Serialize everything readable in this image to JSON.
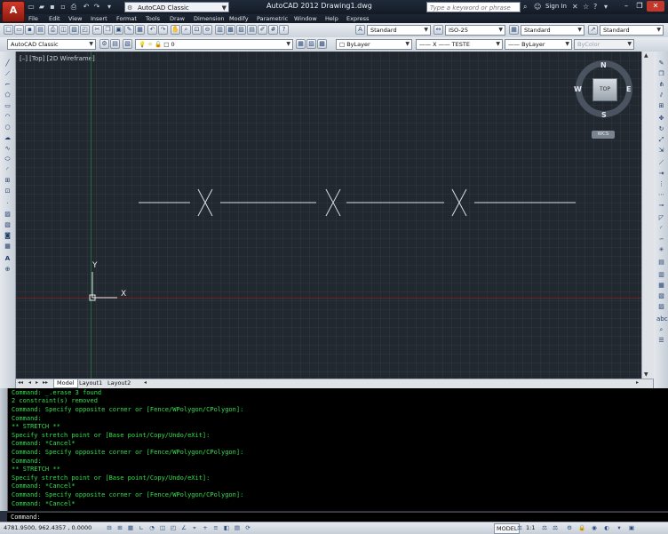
{
  "titlebar": {
    "app_button_label": "A",
    "workspace": "AutoCAD Classic",
    "title": "AutoCAD 2012    Drawing1.dwg",
    "search_placeholder": "Type a keyword or phrase",
    "sign_in": "Sign In"
  },
  "menus": [
    "File",
    "Edit",
    "View",
    "Insert",
    "Format",
    "Tools",
    "Draw",
    "Dimension",
    "Modify",
    "Parametric",
    "Window",
    "Help",
    "Express"
  ],
  "toolbar1": {
    "text_style": "Standard",
    "dim_style": "ISO-25",
    "table_style": "Standard",
    "multileader_style": "Standard"
  },
  "toolbar2": {
    "workspace": "AutoCAD Classic",
    "layer": "0",
    "color": "ByLayer",
    "linetype": "—— X —— TESTE",
    "lineweight": "—— ByLayer",
    "plotstyle": "ByColor"
  },
  "viewport": {
    "label": "[–] [Top] [2D Wireframe]",
    "ucs_x": "X",
    "ucs_y": "Y"
  },
  "viewcube": {
    "north": "N",
    "south": "S",
    "east": "E",
    "west": "W",
    "face": "TOP",
    "wcs": "WCS"
  },
  "layout_tabs": [
    "Model",
    "Layout1",
    "Layout2"
  ],
  "command_history": [
    "Command: _.erase 3 found",
    "2 constraint(s) removed",
    "Command: Specify opposite corner or [Fence/WPolygon/CPolygon]:",
    "Command:",
    "** STRETCH **",
    "Specify stretch point or [Base point/Copy/Undo/eXit]:",
    "Command: *Cancel*",
    "Command: Specify opposite corner or [Fence/WPolygon/CPolygon]:",
    "Command:",
    "** STRETCH **",
    "Specify stretch point or [Base point/Copy/Undo/eXit]:",
    "Command: *Cancel*",
    "Command: Specify opposite corner or [Fence/WPolygon/CPolygon]:",
    "Command: *Cancel*"
  ],
  "command_prompt": "Command:",
  "statusbar": {
    "coordinates": "4781.9500, 962.4357 , 0.0000",
    "model": "MODEL",
    "annotation_scale": "1:1"
  },
  "colors": {
    "canvas": "#212830",
    "command_text": "#2fe04a",
    "ucs_x_axis": "#8a2a2a",
    "ucs_y_axis": "#2a7a3a"
  }
}
